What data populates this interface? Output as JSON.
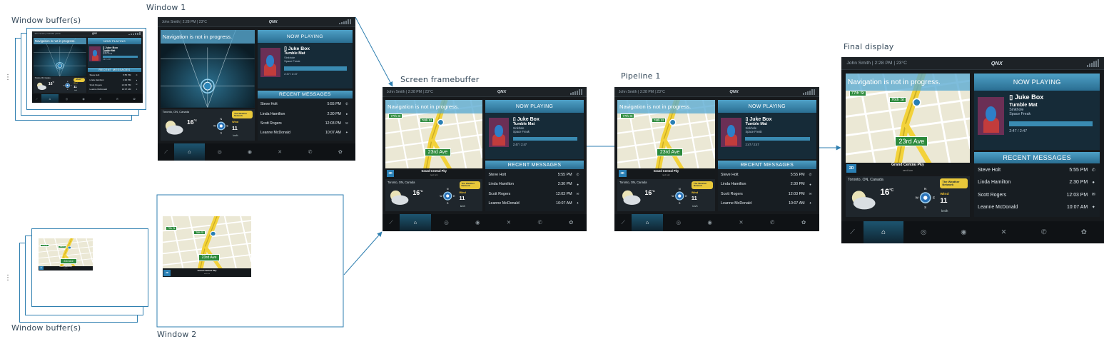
{
  "labels": {
    "window_buffers_top": "Window buffer(s)",
    "window_buffers_bottom": "Window buffer(s)",
    "window1": "Window 1",
    "window2": "Window 2",
    "screen_framebuffer": "Screen framebuffer",
    "pipeline1": "Pipeline 1",
    "final_display": "Final display",
    "ellipsis": "⋮"
  },
  "screen": {
    "status": "John Smith | 2:28 PM | 23°C",
    "logo": "QNX",
    "nav_message": "Navigation is not in progress.",
    "now_playing_header": "NOW PLAYING",
    "track": {
      "artist": "Juke Box",
      "title": "Tumble Mat",
      "album": "Sinkhole",
      "band": "Space Freak",
      "time": "2:47 / 2:47"
    },
    "recent_header": "RECENT MESSAGES",
    "messages": [
      {
        "name": "Steve Holt",
        "time": "5:55 PM",
        "icon": "phone-icon",
        "glyph": "✆"
      },
      {
        "name": "Linda Hamilton",
        "time": "2:30 PM",
        "icon": "chat-icon",
        "glyph": "●"
      },
      {
        "name": "Scott Rogers",
        "time": "12:03 PM",
        "icon": "mail-icon",
        "glyph": "✉"
      },
      {
        "name": "Leanne McDonald",
        "time": "10:07 AM",
        "icon": "bird-icon",
        "glyph": "✦"
      }
    ],
    "weather": {
      "city": "Toronto, ON, Canada",
      "temp": "16",
      "deg": "°C",
      "network": "The Weather Network",
      "wind_label": "Wind",
      "wind_speed": "11",
      "wind_unit": "km/h",
      "compass": {
        "n": "N",
        "s": "S",
        "e": "E",
        "w": "W"
      }
    },
    "dock": [
      {
        "name": "seat-icon",
        "glyph": "⟋",
        "active": false
      },
      {
        "name": "home-icon",
        "glyph": "⌂",
        "active": true
      },
      {
        "name": "navigation-icon",
        "glyph": "◎",
        "active": false
      },
      {
        "name": "media-icon",
        "glyph": "◉",
        "active": false
      },
      {
        "name": "tools-icon",
        "glyph": "✕",
        "active": false
      },
      {
        "name": "phone-icon",
        "glyph": "✆",
        "active": false
      },
      {
        "name": "blackberry-icon",
        "glyph": "✿",
        "active": false
      }
    ]
  },
  "map": {
    "streets": [
      "77th St",
      "76th St",
      "23rd Ave"
    ],
    "mode_button": "2D",
    "street_name": "Grand Central Pky",
    "street_sub": "next turn"
  },
  "colors": {
    "arrow": "#2f7fb0",
    "accent": "#3a8bb2",
    "road": "#f3d23a",
    "sign": "#2c8a3c"
  }
}
